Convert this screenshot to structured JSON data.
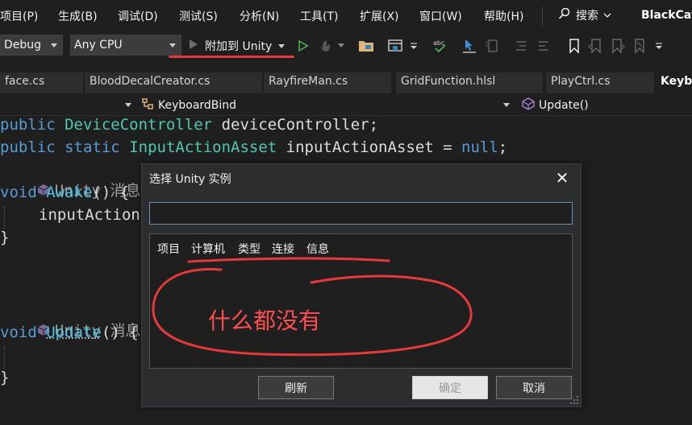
{
  "menubar": {
    "items": [
      "项目(P)",
      "生成(B)",
      "调试(D)",
      "测试(S)",
      "分析(N)",
      "工具(T)",
      "扩展(X)",
      "窗口(W)",
      "帮助(H)"
    ],
    "search_label": "搜索",
    "window_title": "BlackCat"
  },
  "toolbar": {
    "config": "Debug",
    "platform": "Any CPU",
    "attach_label": "附加到 Unity"
  },
  "tabs": [
    "face.cs",
    "BloodDecalCreator.cs",
    "RayfireMan.cs",
    "GridFunction.hlsl",
    "PlayCtrl.cs",
    "Keyb"
  ],
  "navbar": {
    "class_name": "KeyboardBind",
    "member_name": "Update()"
  },
  "code": {
    "line1": [
      "public",
      "DeviceController",
      "deviceController;"
    ],
    "line2": [
      "public",
      "static",
      "InputActionAsset",
      "inputActionAsset = ",
      "null",
      ";"
    ],
    "hint1": "Unity 消息|0 个引用",
    "line4": [
      "void",
      "Awake",
      "() {"
    ],
    "line5": "inputAction",
    "line6": "}",
    "hint2": "Unity 消息|0",
    "line8": [
      "void",
      "Update",
      "() {"
    ],
    "line10": "}"
  },
  "dialog": {
    "title": "选择 Unity 实例",
    "search_value": "",
    "columns": [
      "项目",
      "计算机",
      "类型",
      "连接",
      "信息"
    ],
    "annotation": "什么都没有",
    "refresh_label": "刷新",
    "ok_label": "确定",
    "cancel_label": "取消"
  },
  "colors": {
    "annotation_red": "#e5393b",
    "keyword": "#569cd6",
    "type": "#4ec9b0",
    "method": "#4fc1e9"
  }
}
